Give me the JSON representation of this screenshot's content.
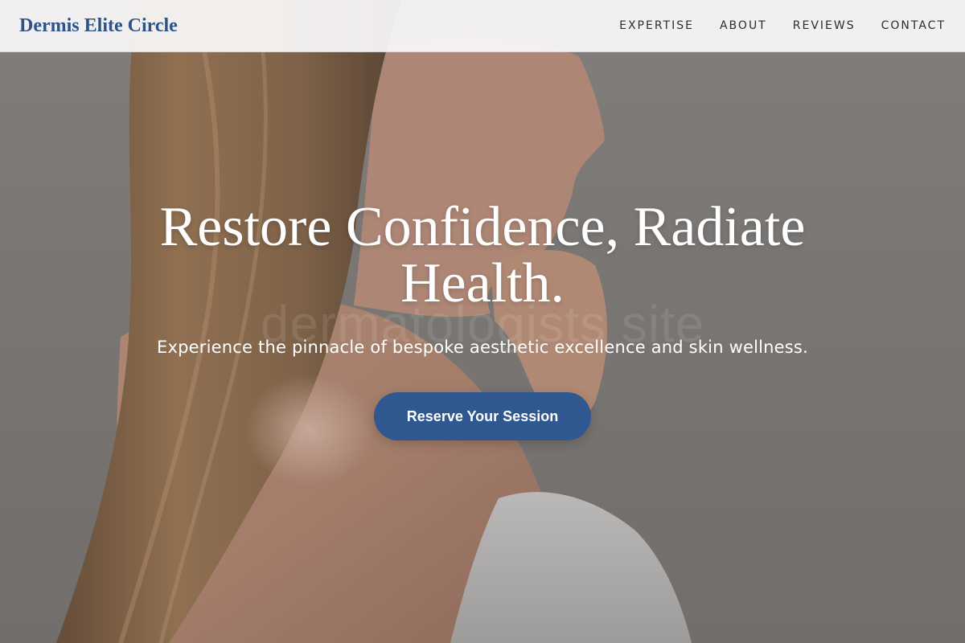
{
  "header": {
    "brand": "Dermis Elite Circle",
    "nav": [
      {
        "label": "EXPERTISE"
      },
      {
        "label": "ABOUT"
      },
      {
        "label": "REVIEWS"
      },
      {
        "label": "CONTACT"
      }
    ]
  },
  "hero": {
    "title": "Restore Confidence, Radiate Health.",
    "subtitle": "Experience the pinnacle of bespoke aesthetic excellence and skin wellness.",
    "cta_label": "Reserve Your Session",
    "watermark": "dermatologists site"
  },
  "colors": {
    "brand": "#2c5489",
    "cta": "#2f5890",
    "header_bg": "#f8f7f6"
  }
}
